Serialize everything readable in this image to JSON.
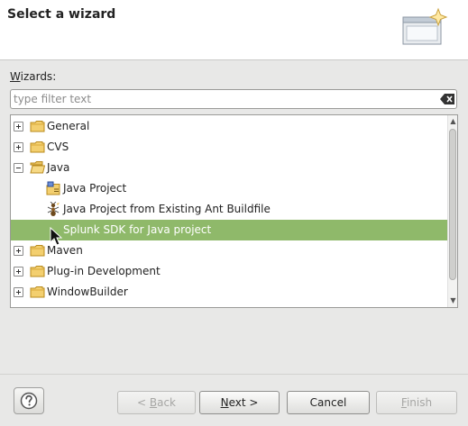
{
  "header": {
    "title": "Select a wizard",
    "image_icon": "wizard-banner-icon"
  },
  "wizards_label": {
    "prefix": "W",
    "rest": "izards:"
  },
  "filter": {
    "placeholder": "type filter text",
    "value": "",
    "clear_icon": "clear-filter-icon"
  },
  "tree": {
    "items": [
      {
        "label": "General",
        "expander": "plus",
        "icon": "folder-icon",
        "level": 0
      },
      {
        "label": "CVS",
        "expander": "plus",
        "icon": "folder-icon",
        "level": 0
      },
      {
        "label": "Java",
        "expander": "minus",
        "icon": "folder-open-icon",
        "level": 0
      },
      {
        "label": "Java Project",
        "expander": null,
        "icon": "java-project-icon",
        "level": 1
      },
      {
        "label": "Java Project from Existing Ant Buildfile",
        "expander": null,
        "icon": "ant-icon",
        "level": 1
      },
      {
        "label": "Splunk SDK for Java project",
        "expander": null,
        "icon": "splunk-project-icon",
        "level": 1,
        "selected": true
      },
      {
        "label": "Maven",
        "expander": "plus",
        "icon": "folder-icon",
        "level": 0
      },
      {
        "label": "Plug-in Development",
        "expander": "plus",
        "icon": "folder-icon",
        "level": 0
      },
      {
        "label": "WindowBuilder",
        "expander": "plus",
        "icon": "folder-icon",
        "level": 0
      }
    ]
  },
  "buttons": {
    "help_icon": "help-icon",
    "back": {
      "prefix": "< ",
      "mnemonic": "B",
      "rest": "ack",
      "enabled": false
    },
    "next": {
      "prefix": "",
      "mnemonic": "N",
      "rest": "ext >",
      "enabled": true
    },
    "cancel": {
      "label": "Cancel",
      "enabled": true
    },
    "finish": {
      "prefix": "",
      "mnemonic": "F",
      "rest": "inish",
      "enabled": false
    }
  },
  "colors": {
    "selection": "#8fb96a",
    "folder": "#e8b84a"
  }
}
